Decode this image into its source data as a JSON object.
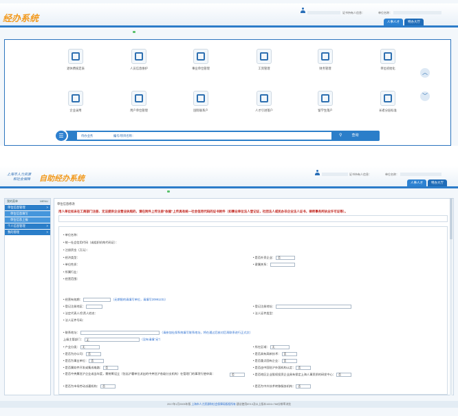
{
  "app": {
    "title": "人力资源和社会保障自助经办系统",
    "logo_short": "经办系统",
    "logo_prefix_1": "上海市人力资源",
    "logo_prefix_2": "和社会保障",
    "logo_main": "自助经办系统"
  },
  "topbar": {
    "user_label": "证书持有人信息：",
    "unit_label": "单位名称：",
    "unit_label_2": "单位名称："
  },
  "tabs": [
    {
      "label": "人事人才"
    },
    {
      "label": "特办大厅"
    }
  ],
  "home": {
    "icons": [
      {
        "label": "退休费核定表",
        "icon": "printer-icon"
      },
      {
        "label": "人员信息维护",
        "icon": "document-icon"
      },
      {
        "label": "事业单位管理",
        "icon": "chat-icon"
      },
      {
        "label": "工资管理",
        "icon": "printer-icon"
      },
      {
        "label": "财务管理",
        "icon": "id-card-icon"
      },
      {
        "label": "单位初始化",
        "icon": "monitor-icon"
      },
      {
        "label": "企业录用",
        "icon": "monitor-icon"
      },
      {
        "label": "用户单位管理",
        "icon": "org-chart-icon"
      },
      {
        "label": "国际联系户",
        "icon": "window-icon"
      },
      {
        "label": "人才引进落户",
        "icon": "calculator-icon"
      },
      {
        "label": "留学生落户",
        "icon": "computer-icon"
      },
      {
        "label": "长者分层标准",
        "icon": "chart-icon"
      }
    ],
    "search": {
      "label_1": "待办业务",
      "label_2": "编号/项目名称：",
      "button": "查询"
    }
  },
  "sidebar": {
    "header": "我的菜单",
    "header_right": "MENU",
    "items": [
      {
        "label": "单位信息管理"
      },
      {
        "label": "单位信息填写"
      },
      {
        "label": "单位信息上报"
      },
      {
        "label": "个人信息管理"
      },
      {
        "label": "我的管理"
      }
    ]
  },
  "form": {
    "breadcrumb": "单位信息修改",
    "notice": "用人单位如未在工商部门注册、无法提供企业营业执照的，请在附件上传注册\"依据\"上传具有统一社会信用代码的证书附件（如事业单位法人登记证，社团法人或民办非企业法人证书，律师事务所执业许可证等）。",
    "fields": {
      "unit_name": "• 单位名称：",
      "credit_code": "• 统一社会信用代码（或组织机构代码证）：",
      "legal_capital": "• 注册资金（万元）：",
      "economic_type": "• 经济类型：",
      "is_foreign": "• 是否外资企业：",
      "is_foreign_val": "否",
      "unit_nature": "• 单位性质：",
      "affiliation": "• 隶属关系：",
      "industry": "• 所属行业：",
      "business_scope": "• 经营范围：",
      "expiry": "• 经营有效期：",
      "expiry_hint": "（无期限的请填写单位，请填写20991231）",
      "reg_district": "• 登记注册地区：",
      "reg_address": "• 登记注册地址：",
      "legal_rep": "• 法定代表人/负责人姓名：",
      "legal_type": "• 法人证件类型：",
      "legal_id": "• 法人证件号码：",
      "contact_addr": "• 联系地址：",
      "contact_hint": "（请参加社保系统填写联系地址，将在通过后核对后再联系进行正式文）",
      "superior": "上级主管部门：",
      "superior_val": "无",
      "superior_hint": "（没有请填\"无\"）",
      "industry_cat": "• 产业分类：",
      "industry_cat_val": "无",
      "location_area": "• 所在区域：",
      "location_area_val": "无",
      "is_office": "• 是否为办公司：",
      "is_office_val": "否",
      "is_high_tech": "• 是否具有高新技术：",
      "is_high_tech_val": "否",
      "is_public": "• 是否为事业单位：",
      "is_public_val": "否",
      "is_soe": "• 是否重点国有企业：",
      "is_soe_val": "否",
      "is_software": "• 是否属软件开发或集成电路：",
      "is_software_val": "否",
      "is_research": "• 是否由中国驻沪外国机构认定：",
      "is_research_val": "否",
      "q1": "• 是否中央属驻沪企业或当年度，需统筹设立（包括沪署单位派出的中央驻沪各级分支机构）在管理门的事项行使申请：",
      "q1_val": "否",
      "q2": "• 是否地区企业股权投资企业具有保定上海人事资质的研发中心：",
      "q2_val": "否",
      "q3": "• 是否为市场劳动派遣机构：",
      "q3_val": "否",
      "q4": "• 是否为中外技术转移服务机构：",
      "q4_val": "否"
    }
  },
  "footer": {
    "text_1": "2017年1月2005年版",
    "link": "上海市人力资源和社会保障局版权所有",
    "text_2": "建议使用IE9.0及以上版本1024×768分辨率浏览"
  },
  "colors": {
    "primary": "#2b7ec9",
    "logo": "#f29a1f",
    "notice_red": "#c0241d"
  }
}
